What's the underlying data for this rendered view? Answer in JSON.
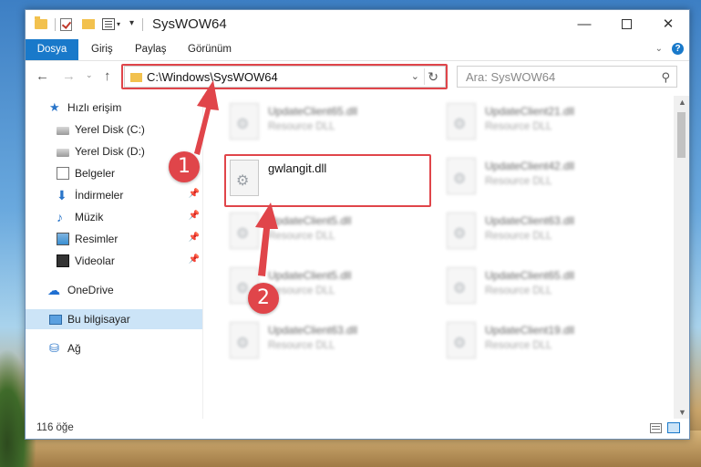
{
  "window": {
    "title": "SysWOW64",
    "controls": {
      "minimize": "—",
      "close": "✕"
    }
  },
  "quick_access_toolbar": {
    "dropdown": "▾",
    "customize": "▾"
  },
  "ribbon": {
    "tabs": [
      "Dosya",
      "Giriş",
      "Paylaş",
      "Görünüm"
    ],
    "expand": "⌄",
    "help": "?"
  },
  "navigation": {
    "back": "←",
    "forward": "→",
    "recent": "⌄",
    "up": "↑",
    "address": "C:\\Windows\\SysWOW64",
    "address_dropdown": "⌄",
    "refresh": "↻",
    "search_placeholder": "Ara: SysWOW64",
    "search_icon": "⚲"
  },
  "sidebar": {
    "items": [
      {
        "label": "Hızlı erişim",
        "icon": "star-icon"
      },
      {
        "label": "Yerel Disk (C:)",
        "icon": "drive-icon"
      },
      {
        "label": "Yerel Disk (D:)",
        "icon": "drive-icon"
      },
      {
        "label": "Belgeler",
        "icon": "document-icon"
      },
      {
        "label": "İndirmeler",
        "icon": "download-icon",
        "pinned": true
      },
      {
        "label": "Müzik",
        "icon": "music-icon",
        "pinned": true
      },
      {
        "label": "Resimler",
        "icon": "pictures-icon",
        "pinned": true
      },
      {
        "label": "Videolar",
        "icon": "video-icon",
        "pinned": true
      },
      {
        "label": "OneDrive",
        "icon": "cloud-icon"
      },
      {
        "label": "Bu bilgisayar",
        "icon": "computer-icon",
        "selected": true
      },
      {
        "label": "Ağ",
        "icon": "network-icon"
      }
    ],
    "pin_glyph": "📌"
  },
  "files": {
    "focused": {
      "name": "gwlangit.dll"
    },
    "background": [
      {
        "name": "UpdateClient65.dll",
        "type": "Resource DLL"
      },
      {
        "name": "UpdateClient21.dll",
        "type": "Resource DLL"
      },
      {
        "name": "UpdateClient42.dll",
        "type": "Resource DLL"
      },
      {
        "name": "UpdateClient5.dll",
        "type": "Resource DLL"
      },
      {
        "name": "UpdateClient63.dll",
        "type": "Resource DLL"
      },
      {
        "name": "UpdateClient5.dll",
        "type": "Resource DLL"
      },
      {
        "name": "UpdateClient65.dll",
        "type": "Resource DLL"
      },
      {
        "name": "UpdateClient63.dll",
        "type": "Resource DLL"
      },
      {
        "name": "UpdateClient19.dll",
        "type": "Resource DLL"
      }
    ]
  },
  "status": {
    "item_count": "116 öğe"
  },
  "scrollbar": {
    "up": "▲",
    "down": "▼"
  },
  "callouts": {
    "first": "1",
    "second": "2"
  },
  "colors": {
    "accent": "#1979ca",
    "highlight": "#e0454a",
    "selected": "#cce4f7"
  }
}
